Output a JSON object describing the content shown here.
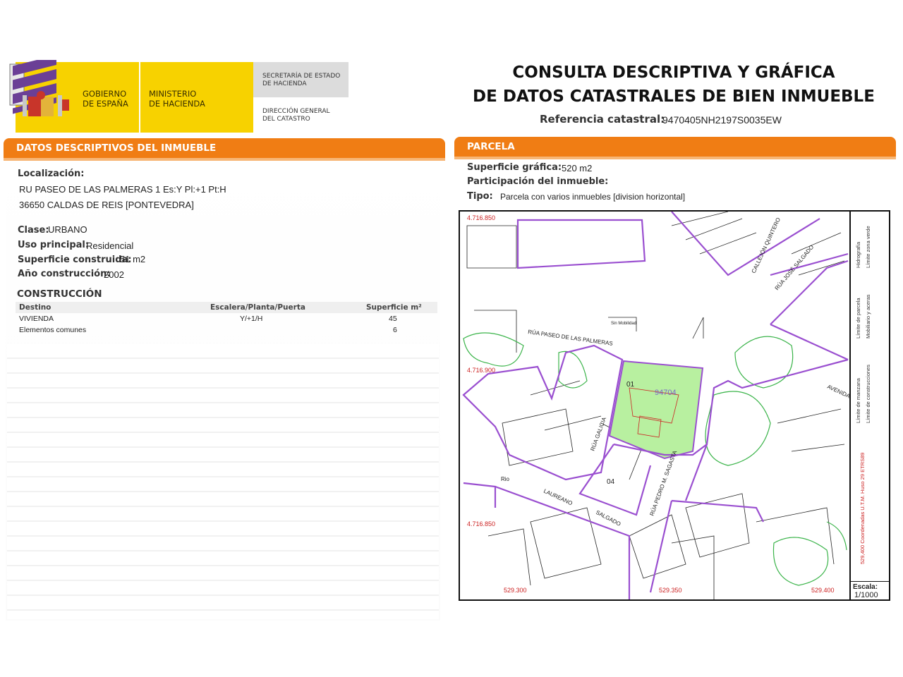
{
  "header": {
    "logo_gobierno": "GOBIERNO\nDE ESPAÑA",
    "logo_ministerio": "MINISTERIO\nDE HACIENDA",
    "secretaria": "SECRETARÍA DE ESTADO\nDE HACIENDA",
    "direccion": "DIRECCIÓN GENERAL\nDEL CATASTRO",
    "title_line1": "CONSULTA DESCRIPTIVA Y GRÁFICA",
    "title_line2": "DE DATOS CATASTRALES DE BIEN INMUEBLE",
    "ref_label": "Referencia catastral:",
    "ref_value": "9470405NH2197S0035EW"
  },
  "datos": {
    "section_title": "DATOS DESCRIPTIVOS DEL INMUEBLE",
    "localizacion_label": "Localización:",
    "direccion_1": "RU PASEO DE LAS PALMERAS 1 Es:Y Pl:+1 Pt:H",
    "direccion_2": "36650 CALDAS DE REIS [PONTEVEDRA]",
    "clase_label": "Clase:",
    "clase_value": "URBANO",
    "uso_label": "Uso principal:",
    "uso_value": "Residencial",
    "superficie_label": "Superficie construida:",
    "superficie_value": "51 m2",
    "anio_label": "Año construcción:",
    "anio_value": "2002"
  },
  "construccion": {
    "title": "CONSTRUCCIÓN",
    "headers": [
      "Destino",
      "Escalera/Planta/Puerta",
      "Superficie m²"
    ],
    "rows": [
      {
        "destino": "VIVIENDA",
        "escalera": "Y/+1/H",
        "superficie": "45"
      },
      {
        "destino": "Elementos comunes",
        "escalera": "",
        "superficie": "6"
      }
    ]
  },
  "parcela": {
    "section_title": "PARCELA",
    "sup_label": "Superficie gráfica:",
    "sup_value": "520 m2",
    "participacion_label": "Participación del inmueble:",
    "tipo_label": "Tipo:",
    "tipo_value": "Parcela con varios inmuebles [division horizontal]"
  },
  "map": {
    "coord_y_top": "4.716.850",
    "coord_y_mid": "4.716.900",
    "coord_y_bottom": "4.716.850",
    "coord_x_left": "529.300",
    "coord_x_mid": "529.350",
    "coord_x_right": "529.400",
    "street_palmeras": "RÚA PASEO DE LAS PALMERAS",
    "street_sin_mobilidad": "Sin Mobilidad",
    "street_laureano": "LAUREANO",
    "street_salgado": "SALGADO",
    "street_pedro": "RÚA PEDRO M. SAGASTA",
    "street_ave": "AVENIDA",
    "street_jose_salgado": "RÚA JOSÉ SALGADO",
    "street_callejon": "CALLEJÓN QUINTERO",
    "street_rua_gal": "RÚA GALICIA",
    "parcel_number": "94704",
    "label_01": "01",
    "label_04": "04",
    "label_rio": "Rio",
    "legend_limite_manzana": "Límite de manzana",
    "legend_limite_parcela": "Límite de parcela",
    "legend_hidrografia": "Hidrografía",
    "legend_construcciones": "Límite de construcciones",
    "legend_mobiliario": "Mobiliario y aceras",
    "legend_zona_verde": "Límite zona verde",
    "legend_coords": "529,400 Coordenadas U.T.M. Huso 29 ETRS89",
    "scale_label": "Escala:",
    "scale_value": "1/1000"
  },
  "colors": {
    "orange_bar": "#f07d14",
    "logo_yellow": "#f7d200",
    "parcel_fill": "#b8f0a0",
    "block_line": "#9a4fd0",
    "green_line": "#3bb44a",
    "red_text": "#cc2222"
  }
}
